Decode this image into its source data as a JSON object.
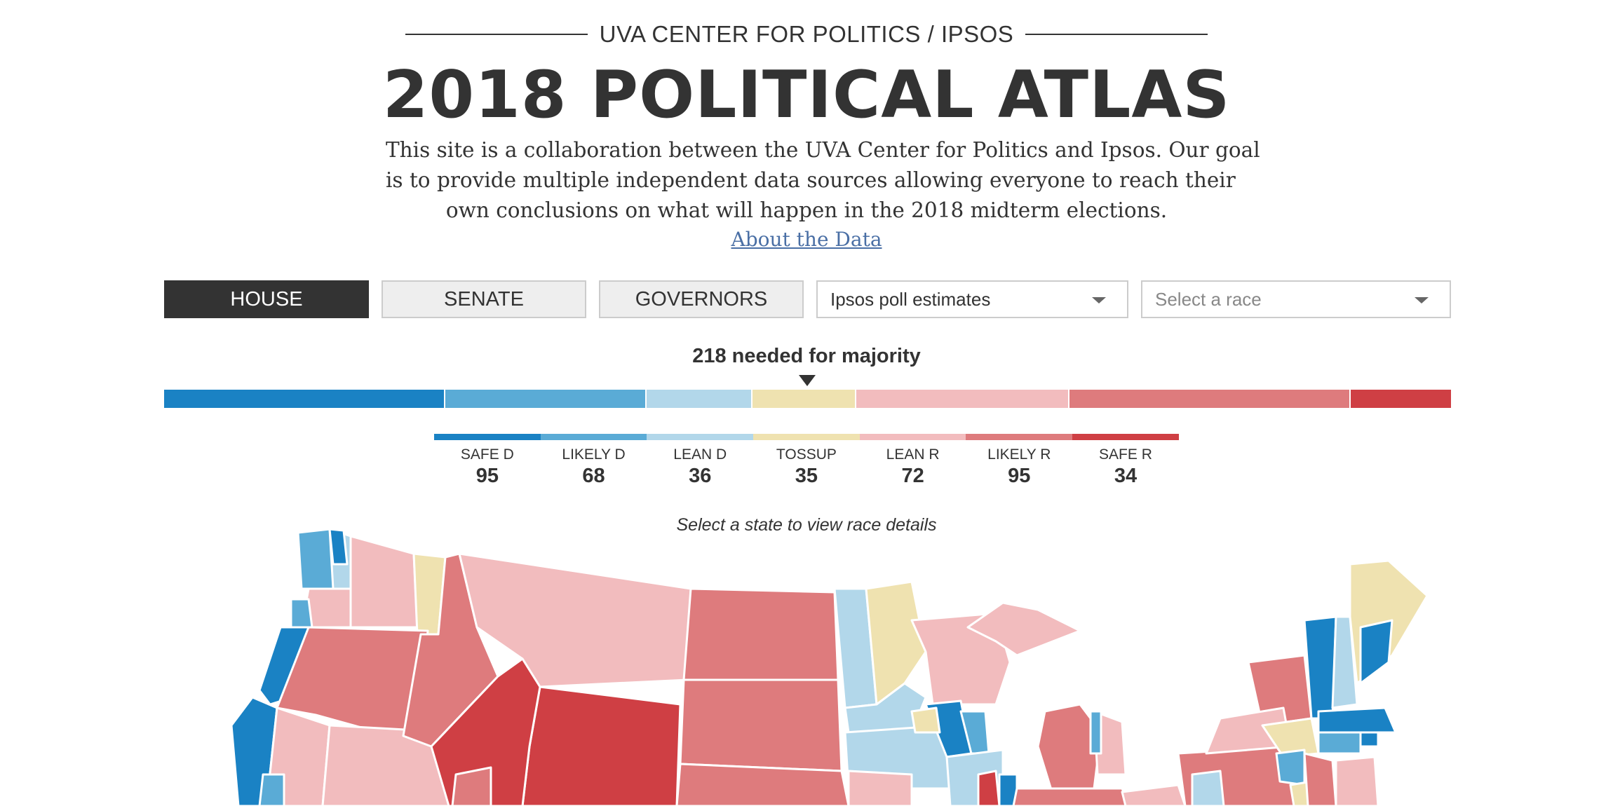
{
  "header": {
    "kicker": "UVA CENTER FOR POLITICS / IPSOS",
    "title": "2018 POLITICAL ATLAS",
    "intro_lines": [
      "This site is a collaboration between the UVA Center for Politics and Ipsos. Our goal",
      "is to provide multiple independent data sources allowing everyone to reach their",
      "own conclusions on what will happen in the 2018 midterm elections."
    ],
    "about_link": "About the Data"
  },
  "controls": {
    "tabs": [
      "HOUSE",
      "SENATE",
      "GOVERNORS"
    ],
    "active_tab": "HOUSE",
    "source_select": {
      "value": "Ipsos poll estimates"
    },
    "race_select": {
      "placeholder": "Select a race"
    }
  },
  "summary": {
    "majority_label": "218 needed for majority",
    "categories": [
      {
        "label": "SAFE D",
        "count": 95,
        "color": "#1a82c4"
      },
      {
        "label": "LIKELY D",
        "count": 68,
        "color": "#5aabd6"
      },
      {
        "label": "LEAN D",
        "count": 36,
        "color": "#b2d7ea"
      },
      {
        "label": "TOSSUP",
        "count": 35,
        "color": "#efe2b0"
      },
      {
        "label": "LEAN R",
        "count": 72,
        "color": "#f2bcbe"
      },
      {
        "label": "LIKELY R",
        "count": 95,
        "color": "#de7b7d"
      },
      {
        "label": "SAFE R",
        "count": 34,
        "color": "#cf3f44"
      }
    ]
  },
  "map": {
    "hint": "Select a state to view race details"
  }
}
